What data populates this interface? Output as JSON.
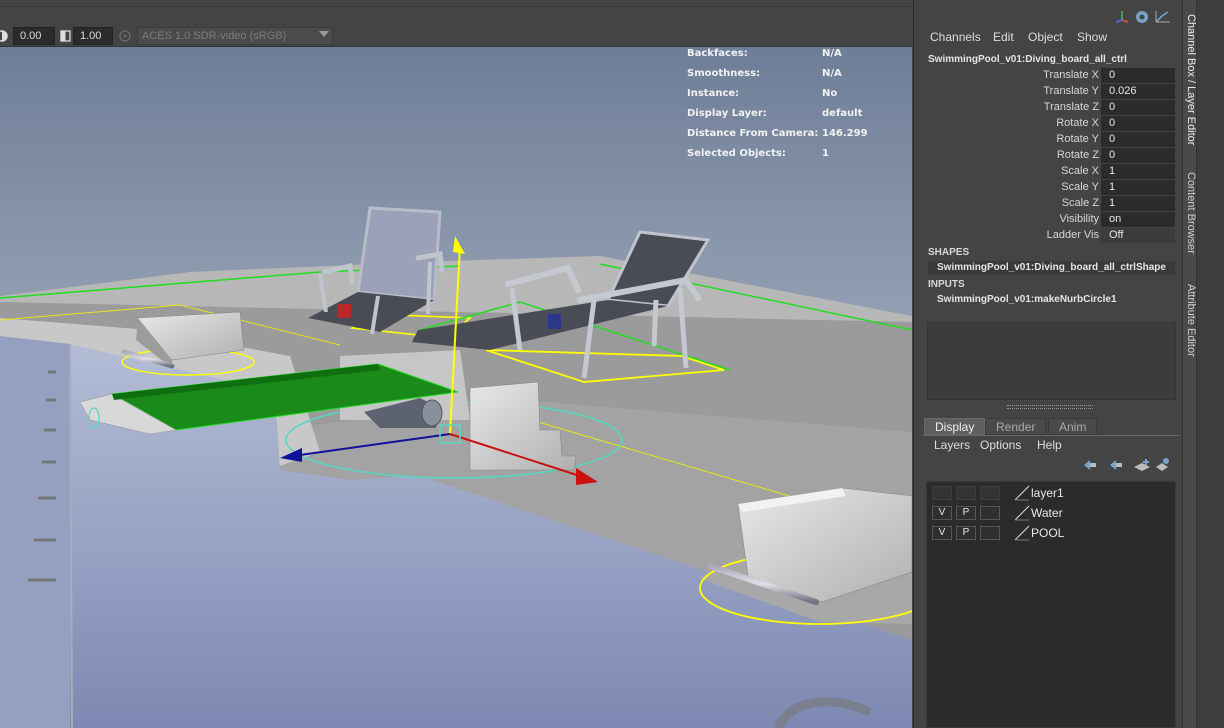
{
  "viewport": {
    "toolbar": {
      "exposure_value": "0.00",
      "gamma_value": "1.00",
      "colorspace": "ACES 1.0 SDR-video (sRGB)"
    },
    "hud": [
      {
        "label": "Backfaces:",
        "value": "N/A"
      },
      {
        "label": "Smoothness:",
        "value": "N/A"
      },
      {
        "label": "Instance:",
        "value": "No"
      },
      {
        "label": "Display Layer:",
        "value": "default"
      },
      {
        "label": "Distance From Camera:",
        "value": "146.299"
      },
      {
        "label": "Selected Objects:",
        "value": "1"
      }
    ]
  },
  "channel_box": {
    "menus": [
      "Channels",
      "Edit",
      "Object",
      "Show"
    ],
    "node_name": "SwimmingPool_v01:Diving_board_all_ctrl",
    "attributes": [
      {
        "label": "Translate X",
        "value": "0"
      },
      {
        "label": "Translate Y",
        "value": "0.026"
      },
      {
        "label": "Translate Z",
        "value": "0"
      },
      {
        "label": "Rotate X",
        "value": "0"
      },
      {
        "label": "Rotate Y",
        "value": "0"
      },
      {
        "label": "Rotate Z",
        "value": "0"
      },
      {
        "label": "Scale X",
        "value": "1"
      },
      {
        "label": "Scale Y",
        "value": "1"
      },
      {
        "label": "Scale Z",
        "value": "1"
      },
      {
        "label": "Visibility",
        "value": "on"
      },
      {
        "label": "Ladder Vis",
        "value": "Off"
      }
    ],
    "shapes_heading": "SHAPES",
    "shape_item": "SwimmingPool_v01:Diving_board_all_ctrlShape",
    "inputs_heading": "INPUTS",
    "input_item": "SwimmingPool_v01:makeNurbCircle1"
  },
  "layer_editor": {
    "tabs": [
      "Display",
      "Render",
      "Anim"
    ],
    "menus": [
      "Layers",
      "Options",
      "Help"
    ],
    "layers": [
      {
        "v": "",
        "p": "",
        "name": "layer1"
      },
      {
        "v": "V",
        "p": "P",
        "name": "Water"
      },
      {
        "v": "V",
        "p": "P",
        "name": "POOL"
      }
    ]
  },
  "side_tabs": [
    "Channel Box / Layer Editor",
    "Content Browser",
    "Attribute Editor"
  ],
  "colors": {
    "selection_green": "#1aa31a",
    "manip_yellow": "#ffff00",
    "manip_red": "#cc1111",
    "manip_blue": "#111199",
    "manip_cyan": "#55d8c0"
  }
}
